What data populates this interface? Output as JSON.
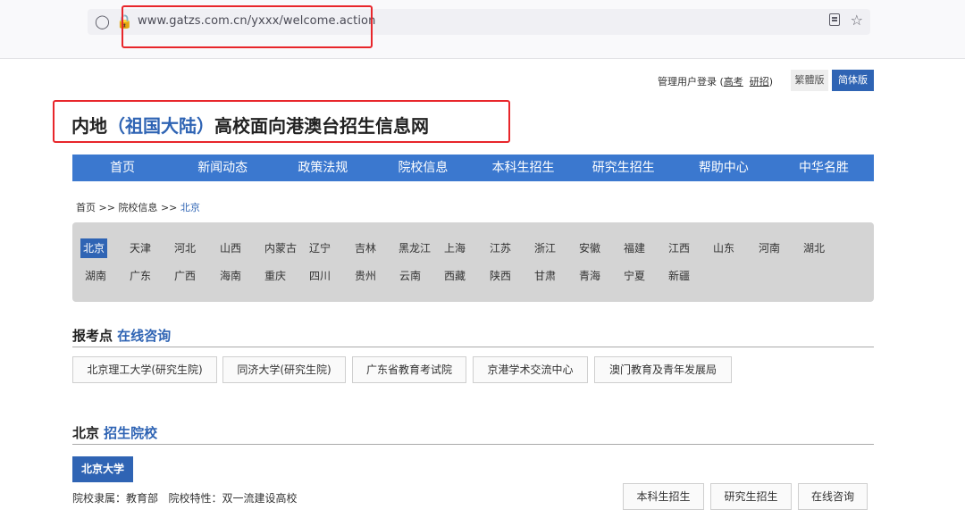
{
  "browser": {
    "url": "www.gatzs.com.cn/yxxx/welcome.action",
    "shield_icon": "shield-icon",
    "lock_icon": "lock-icon"
  },
  "header": {
    "login_prefix": "管理用户登录 (",
    "login_gaokao": "高考",
    "login_yanzhao": "研招",
    "login_suffix": ")",
    "lang_traditional": "繁體版",
    "lang_simplified": "简体版"
  },
  "site_title": {
    "part1": "内地",
    "part2": "（祖国大陆）",
    "part3": "高校面向港澳台招生信息网"
  },
  "nav": [
    "首页",
    "新闻动态",
    "政策法规",
    "院校信息",
    "本科生招生",
    "研究生招生",
    "帮助中心",
    "中华名胜"
  ],
  "breadcrumb": {
    "home": "首页",
    "sep": ">>",
    "section": "院校信息",
    "current": "北京"
  },
  "provinces": {
    "row1": [
      "北京",
      "天津",
      "河北",
      "山西",
      "内蒙古",
      "辽宁",
      "吉林",
      "黑龙江",
      "上海",
      "江苏",
      "浙江",
      "安徽",
      "福建",
      "江西",
      "山东",
      "河南",
      "湖北"
    ],
    "row2": [
      "湖南",
      "广东",
      "广西",
      "海南",
      "重庆",
      "四川",
      "贵州",
      "云南",
      "西藏",
      "陕西",
      "甘肃",
      "青海",
      "宁夏",
      "新疆"
    ],
    "selected": "北京"
  },
  "exam_points": {
    "heading_plain": "报考点",
    "heading_blue": "在线咨询",
    "items": [
      "北京理工大学(研究生院)",
      "同济大学(研究生院)",
      "广东省教育考试院",
      "京港学术交流中心",
      "澳门教育及青年发展局"
    ]
  },
  "schools": {
    "heading_plain": "北京",
    "heading_blue": "招生院校",
    "school_name": "北京大学",
    "info": "院校隶属：教育部   院校特性：双一流建设高校",
    "buttons": [
      "本科生招生",
      "研究生招生",
      "在线咨询"
    ]
  }
}
